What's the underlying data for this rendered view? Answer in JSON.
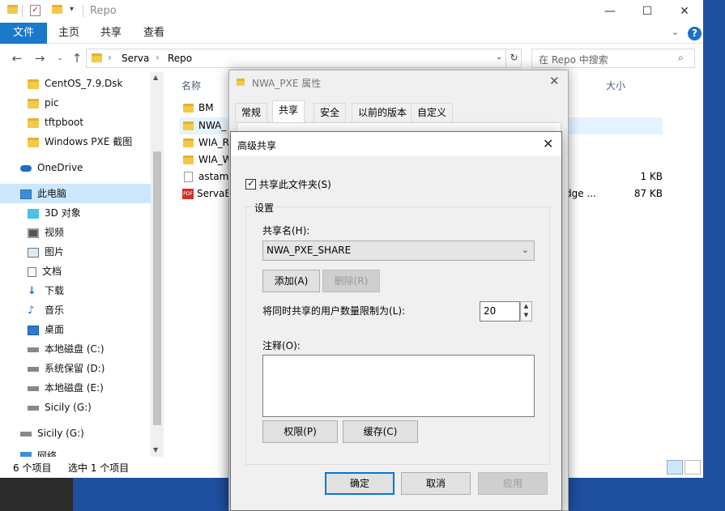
{
  "window": {
    "title": "Repo",
    "ribbon_tabs": [
      "文件",
      "主页",
      "共享",
      "查看"
    ],
    "minimize": "—",
    "maximize": "☐",
    "close": "✕"
  },
  "address": {
    "crumbs": [
      "Serva",
      "Repo"
    ],
    "search_placeholder": "在 Repo 中搜索"
  },
  "sidebar": {
    "items": [
      {
        "label": "CentOS_7.9.Dsk",
        "icon": "folder-icon"
      },
      {
        "label": "pic",
        "icon": "folder-icon"
      },
      {
        "label": "tftpboot",
        "icon": "folder-icon"
      },
      {
        "label": "Windows PXE 截图",
        "icon": "folder-icon"
      },
      {
        "label": "OneDrive",
        "icon": "cloud-icon"
      },
      {
        "label": "此电脑",
        "icon": "computer-icon"
      },
      {
        "label": "3D 对象",
        "icon": "cube-icon"
      },
      {
        "label": "视频",
        "icon": "video-icon"
      },
      {
        "label": "图片",
        "icon": "picture-icon"
      },
      {
        "label": "文档",
        "icon": "document-icon"
      },
      {
        "label": "下载",
        "icon": "download-icon"
      },
      {
        "label": "音乐",
        "icon": "music-icon"
      },
      {
        "label": "桌面",
        "icon": "desktop-icon"
      },
      {
        "label": "本地磁盘 (C:)",
        "icon": "drive-icon"
      },
      {
        "label": "系统保留 (D:)",
        "icon": "drive-icon"
      },
      {
        "label": "本地磁盘 (E:)",
        "icon": "drive-icon"
      },
      {
        "label": "Sicily (G:)",
        "icon": "drive-icon"
      },
      {
        "label": "Sicily (G:)",
        "icon": "drive-icon"
      },
      {
        "label": "网络",
        "icon": "network-icon"
      }
    ]
  },
  "filelist": {
    "columns": {
      "name": "名称",
      "size": "大小"
    },
    "rows": [
      {
        "name": "BM",
        "type": "folder",
        "size": ""
      },
      {
        "name": "NWA_",
        "type": "folder",
        "size": ""
      },
      {
        "name": "WIA_R",
        "type": "folder",
        "size": ""
      },
      {
        "name": "WIA_W",
        "type": "folder",
        "size": ""
      },
      {
        "name": "astamp",
        "type": "file",
        "size": "1 KB"
      },
      {
        "name": "ServaE",
        "type": "pdf",
        "size": "87 KB"
      }
    ],
    "partial_text": "dge ..."
  },
  "status": {
    "item_count": "6 个项目",
    "selected": "选中 1 个项目"
  },
  "properties": {
    "title": "NWA_PXE 属性",
    "tabs": [
      "常规",
      "共享",
      "安全",
      "以前的版本",
      "自定义"
    ]
  },
  "advanced": {
    "title": "高级共享",
    "share_checkbox": "共享此文件夹(S)",
    "settings_legend": "设置",
    "share_name_label": "共享名(H):",
    "share_name_value": "NWA_PXE_SHARE",
    "add_button": "添加(A)",
    "remove_button": "删除(R)",
    "limit_label": "将同时共享的用户数量限制为(L):",
    "limit_value": "20",
    "comment_label": "注释(O):",
    "permissions_button": "权限(P)",
    "cache_button": "缓存(C)",
    "ok_button": "确定",
    "cancel_button": "取消",
    "apply_button": "应用"
  },
  "colors": {
    "accent": "#1979ca",
    "selection": "#cce8ff",
    "desktop": "#1f4f9f"
  }
}
